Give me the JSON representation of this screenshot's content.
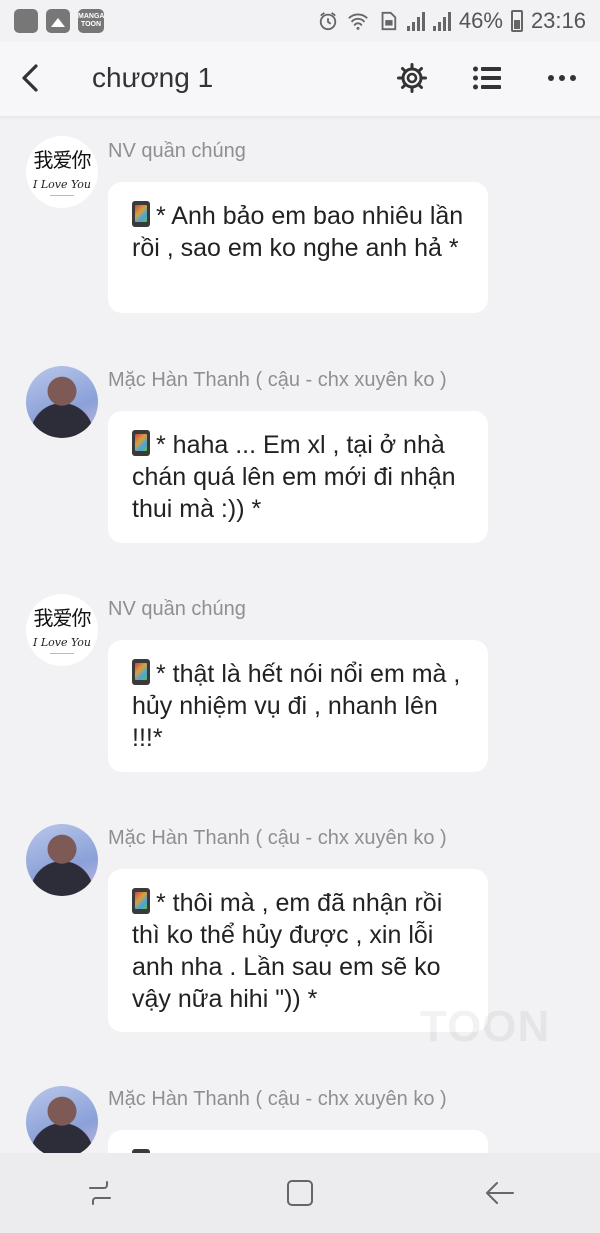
{
  "status_bar": {
    "app_icon_label": "MANGA TOON",
    "battery": "46%",
    "time": "23:16"
  },
  "header": {
    "title": "chương 1",
    "icons": [
      "back-arrow-icon",
      "gear-icon",
      "list-icon",
      "more-icon"
    ]
  },
  "avatar_text": {
    "chinese": "我爱你",
    "english": "I Love You"
  },
  "messages": [
    {
      "name": "NV quần chúng",
      "text": "* Anh bảo em bao nhiêu lần rồi , sao em ko nghe anh hả *"
    },
    {
      "name": "Mặc Hàn Thanh ( cậu - chx xuyên ko )",
      "text": "* haha ... Em xl , tại ở nhà chán quá lên em mới đi nhận thui mà :)) *"
    },
    {
      "name": "NV quần chúng",
      "text": "* thật là hết nói nổi em mà , hủy nhiệm vụ đi , nhanh lên !!!*"
    },
    {
      "name": "Mặc Hàn Thanh ( cậu - chx xuyên ko )",
      "text": "* thôi mà , em đã nhận rồi thì ko thể hủy được , xin lỗi anh nha . Lần sau em sẽ ko vậy nữa hihi \")) *"
    },
    {
      "name": "Mặc Hàn Thanh ( cậu - chx xuyên ko )",
      "text": ""
    }
  ],
  "watermark": "TOON",
  "nav_bar": {
    "icons": [
      "recent-apps-icon",
      "home-icon",
      "back-icon"
    ]
  }
}
